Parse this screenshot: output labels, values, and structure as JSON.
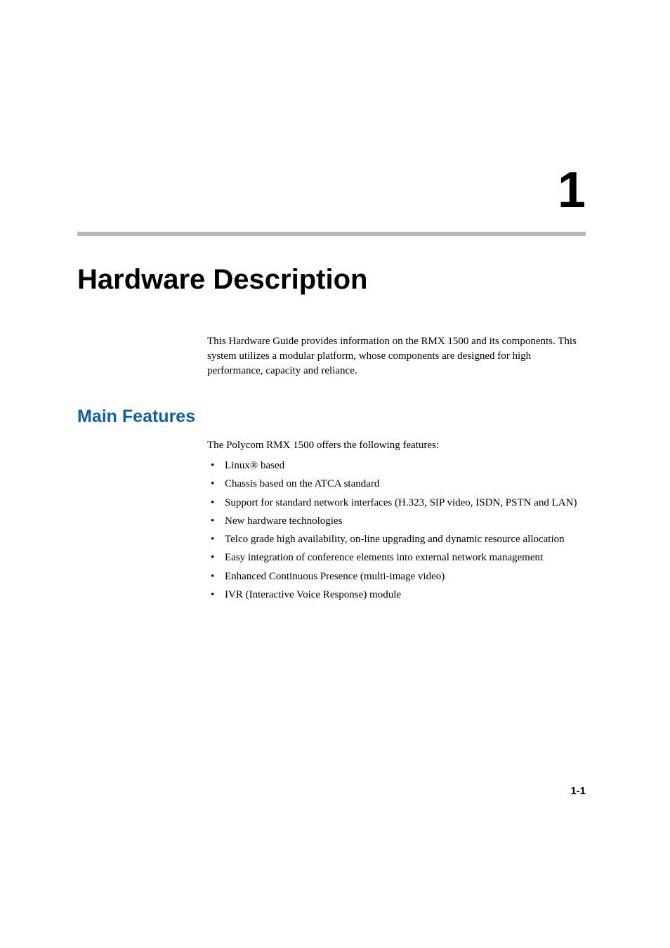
{
  "chapter": {
    "number": "1",
    "title": "Hardware Description"
  },
  "intro": "This Hardware Guide provides information on the RMX 1500 and its components. This system utilizes a modular platform, whose components are designed for high performance, capacity and reliance.",
  "section": {
    "heading": "Main Features",
    "intro": "The Polycom RMX 1500 offers the following features:",
    "bullets": [
      "Linux® based",
      "Chassis based on the ATCA standard",
      "Support for standard network interfaces (H.323, SIP video, ISDN, PSTN and LAN)",
      "New hardware technologies",
      "Telco grade high availability, on-line upgrading and dynamic resource allocation",
      "Easy integration of conference elements into external network management",
      "Enhanced Continuous Presence (multi-image video)",
      "IVR (Interactive Voice Response) module"
    ]
  },
  "pageNumber": "1-1"
}
